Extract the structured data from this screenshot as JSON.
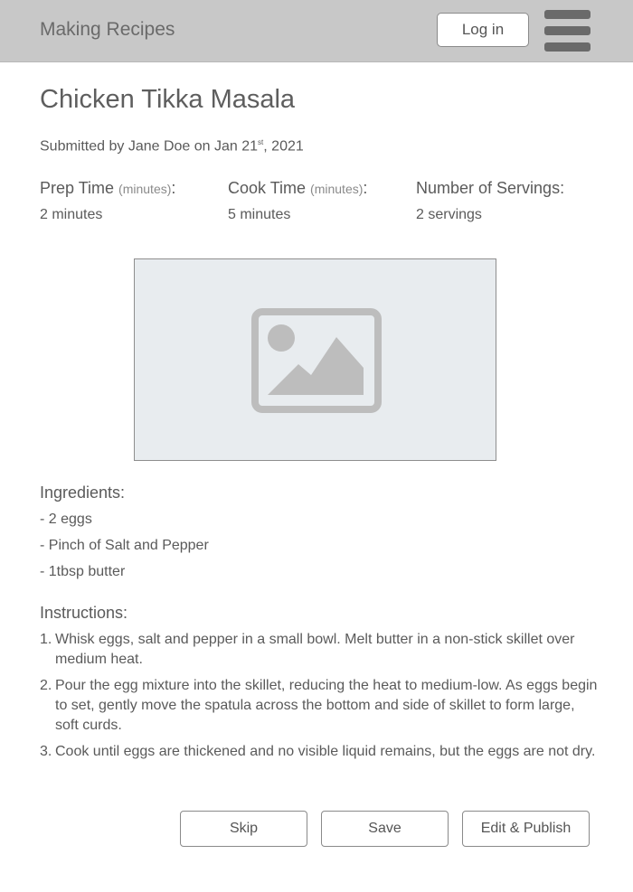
{
  "header": {
    "brand": "Making Recipes",
    "login_label": "Log in",
    "menu_icon": "hamburger-menu-icon"
  },
  "recipe": {
    "title": "Chicken Tikka Masala",
    "submitted_prefix": "Submitted by Jane Doe on Jan 21",
    "submitted_suffix": "st",
    "submitted_year": ", 2021",
    "prep": {
      "label": "Prep Time",
      "unit": "(minutes)",
      "colon": ":",
      "value": "2 minutes"
    },
    "cook": {
      "label": "Cook Time",
      "unit": "(minutes)",
      "colon": ":",
      "value": "5 minutes"
    },
    "servings": {
      "label": "Number of Servings:",
      "value": "2 servings"
    },
    "image_icon": "image-placeholder-icon",
    "ingredients_title": "Ingredients:",
    "ingredients": [
      "- 2 eggs",
      "- Pinch of Salt and Pepper",
      "- 1tbsp butter"
    ],
    "instructions_title": "Instructions:",
    "instructions": [
      {
        "num": "1.",
        "text": "Whisk eggs, salt and pepper in a small bowl. Melt butter in a non-stick skillet over medium heat."
      },
      {
        "num": "2.",
        "text": "Pour the egg mixture into the skillet, reducing the heat to medium-low. As eggs begin to set, gently move the spatula across the bottom and side of skillet to form large, soft curds."
      },
      {
        "num": "3.",
        "text": "Cook until eggs are thickened and no visible liquid remains, but the eggs are not dry."
      }
    ]
  },
  "actions": {
    "skip": "Skip",
    "save": "Save",
    "edit_publish": "Edit & Publish"
  },
  "colors": {
    "header_bg": "#c8c8c8",
    "image_bg": "#e8ecef",
    "icon": "#bdbdbd",
    "text": "#5a5a5a"
  }
}
